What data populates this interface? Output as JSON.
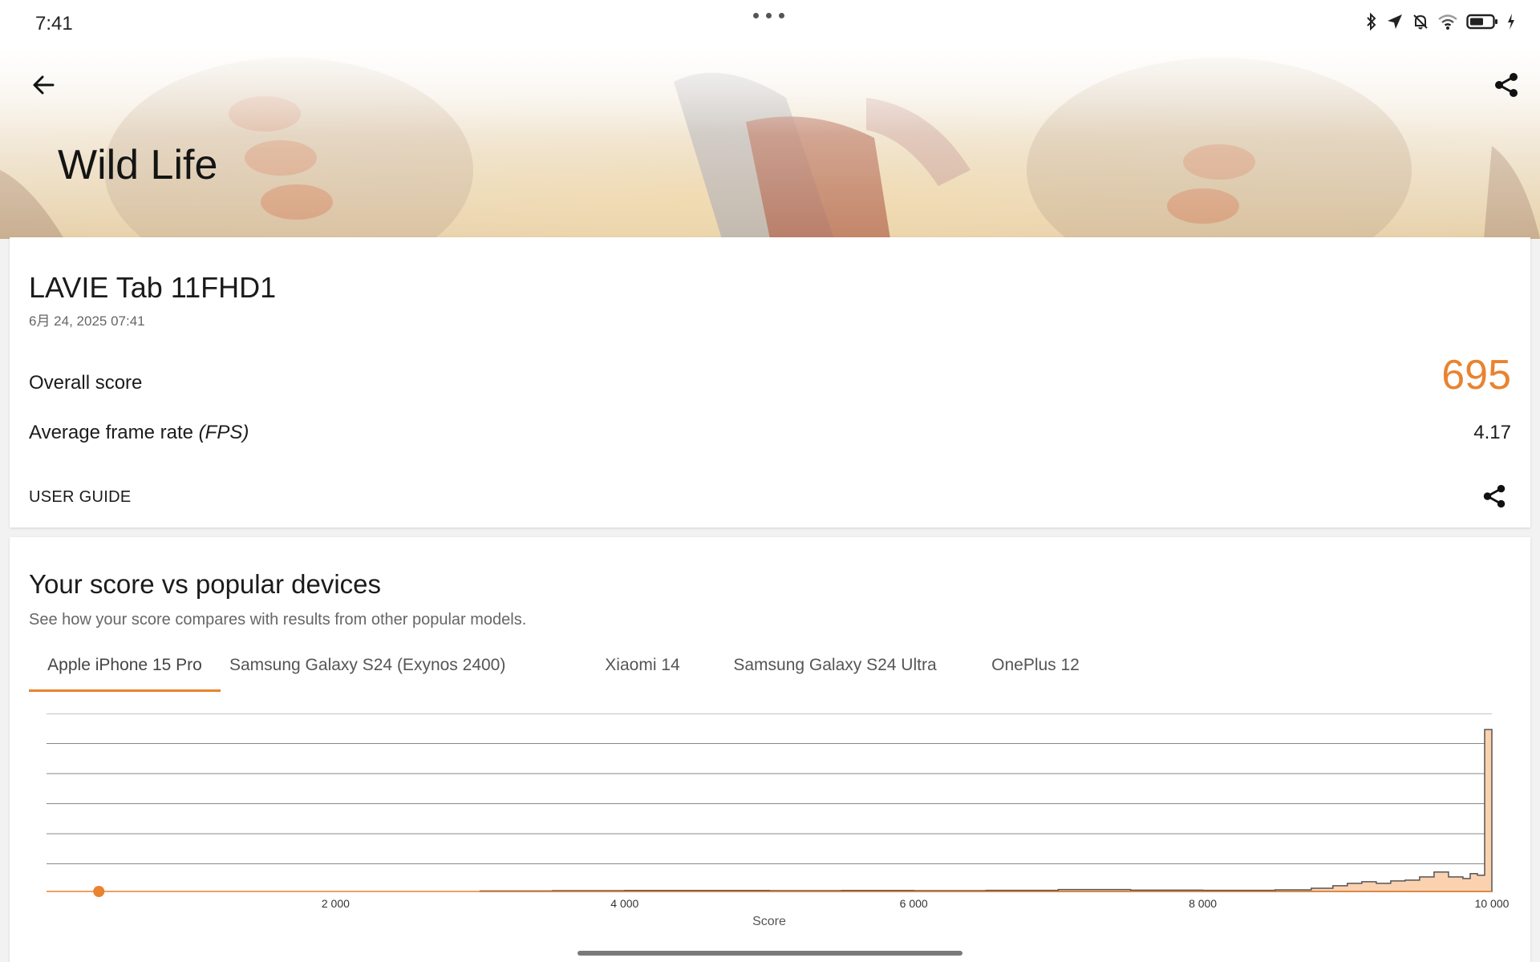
{
  "status_bar": {
    "time": "7:41",
    "icons": [
      "bluetooth-icon",
      "location-icon",
      "mute-bell-icon",
      "wifi-icon",
      "battery-icon",
      "charging-icon"
    ]
  },
  "header": {
    "title": "Wild Life"
  },
  "result": {
    "device_name": "LAVIE Tab 11FHD1",
    "date": "6月 24, 2025 07:41",
    "overall_label": "Overall score",
    "overall_value": "695",
    "fps_label_main": "Average frame rate ",
    "fps_label_unit": "(FPS)",
    "fps_value": "4.17",
    "user_guide": "USER GUIDE"
  },
  "comparison": {
    "title": "Your score vs popular devices",
    "subtitle": "See how your score compares with results from other popular models.",
    "tabs": [
      {
        "label": "Apple iPhone 15 Pro",
        "active": true
      },
      {
        "label": "Samsung Galaxy S24 (Exynos 2400)",
        "active": false
      },
      {
        "label": "Xiaomi 14",
        "active": false
      },
      {
        "label": "Samsung Galaxy S24 Ultra",
        "active": false
      },
      {
        "label": "OnePlus 12",
        "active": false
      }
    ]
  },
  "colors": {
    "accent": "#e9832f",
    "bar_fill": "#fbd2b0",
    "bar_stroke": "#555555",
    "grid": "#888888"
  },
  "chart_data": {
    "type": "area",
    "xlabel": "Score",
    "ylabel": "",
    "xlim": [
      0,
      10000
    ],
    "x_ticks": [
      "2 000",
      "4 000",
      "6 000",
      "8 000",
      "10 000"
    ],
    "x_tick_values": [
      2000,
      4000,
      6000,
      8000,
      10000
    ],
    "your_score": 695,
    "grid": true,
    "series": [
      {
        "x": [
          3000,
          3500,
          4000,
          4500,
          5000,
          5500,
          6000,
          6500,
          7000,
          7500,
          8000,
          8500,
          8750,
          8900,
          9000,
          9100,
          9200,
          9300,
          9400,
          9500,
          9600,
          9700,
          9800,
          9850,
          9900,
          9950,
          10000
        ],
        "values": [
          0.003,
          0.005,
          0.006,
          0.006,
          0.005,
          0.006,
          0.005,
          0.007,
          0.012,
          0.008,
          0.007,
          0.01,
          0.02,
          0.035,
          0.05,
          0.06,
          0.05,
          0.065,
          0.07,
          0.09,
          0.12,
          0.09,
          0.08,
          0.11,
          0.1,
          1.0,
          0.0
        ]
      }
    ]
  }
}
